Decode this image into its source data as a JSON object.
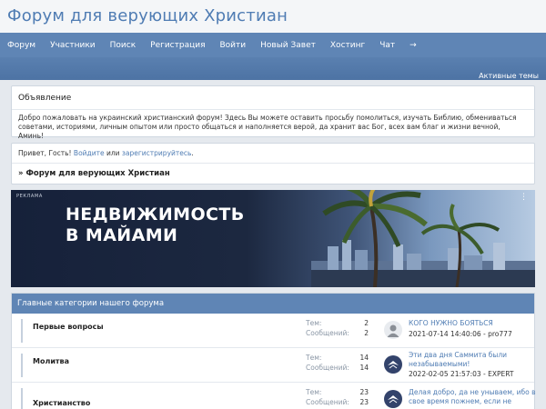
{
  "site": {
    "title": "Форум для верующих Христиан"
  },
  "nav": {
    "items": [
      {
        "label": "Форум"
      },
      {
        "label": "Участники"
      },
      {
        "label": "Поиск"
      },
      {
        "label": "Регистрация"
      },
      {
        "label": "Войти"
      },
      {
        "label": "Новый Завет"
      },
      {
        "label": "Хостинг"
      },
      {
        "label": "Чат"
      },
      {
        "label": "→"
      }
    ]
  },
  "subbar": {
    "active_topics": "Активные темы"
  },
  "announcement": {
    "title": "Объявление",
    "text": "Добро пожаловать на украинский христианский форум! Здесь Вы можете оставить просьбу помолиться, изучать Библию, обмениваться советами, историями, личным опытом или просто общаться и наполняется верой, да хранит вас Бог, всех вам благ и жизни вечной, Аминь!"
  },
  "greeting": {
    "hello": "Привет, Гость!",
    "login": "Войдите",
    "or": "или",
    "register": "зарегистрируйтесь",
    "end": "."
  },
  "breadcrumb": {
    "text": "» Форум для верующих Христиан"
  },
  "banner": {
    "label": "РЕКЛАМА",
    "headline_line1": "НЕДВИЖИМОСТЬ",
    "headline_line2": "В МАЙАМИ",
    "menu": "⋮"
  },
  "categories": {
    "header": "Главные категории нашего форума",
    "topics_label": "Тем:",
    "posts_label": "Сообщений:",
    "rows": [
      {
        "name": "Первые вопросы",
        "topics": "2",
        "posts": "2",
        "last_title": "КОГО НУЖНО БОЯТЬСЯ",
        "last_meta": "2021-07-14 14:40:06 - pro777",
        "avatar": "user-placeholder-icon"
      },
      {
        "name": "Молитва",
        "topics": "14",
        "posts": "14",
        "last_title": "Эти два дня Саммита были незабываемыми!",
        "last_meta": "2022-02-05 21:57:03 - EXPERT",
        "avatar": "expert-avatar-icon"
      },
      {
        "name": "Христианство",
        "topics": "23",
        "posts": "23",
        "last_title": "Делая добро, да не унываем, ибо в свое время пожнем, если не",
        "last_meta": "",
        "avatar": "expert-avatar-icon"
      }
    ]
  },
  "colors": {
    "accent": "#5f85b5",
    "link": "#4f7cb3",
    "title": "#4f7cb3"
  }
}
